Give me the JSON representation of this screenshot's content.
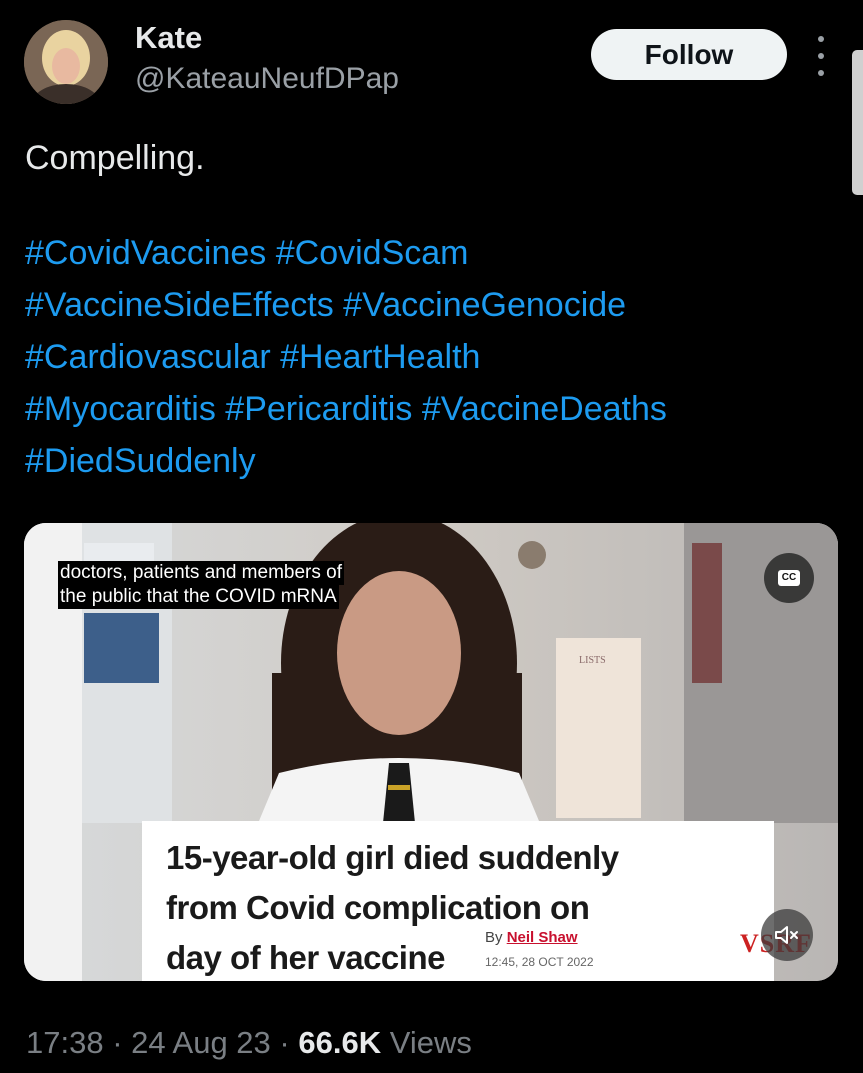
{
  "author": {
    "name": "Kate",
    "handle": "@KateauNeufDPap",
    "follow_label": "Follow"
  },
  "tweet": {
    "text": "Compelling.",
    "hashtag_lines": [
      [
        "#CovidVaccines",
        "#CovidScam"
      ],
      [
        "#VaccineSideEffects",
        "#VaccineGenocide"
      ],
      [
        "#Cardiovascular",
        "#HeartHealth"
      ],
      [
        "#Myocarditis",
        "#Pericarditis",
        "#VaccineDeaths"
      ],
      [
        "#DiedSuddenly"
      ]
    ]
  },
  "media": {
    "caption_line1": "doctors, patients and members of",
    "caption_line2": "the public that the COVID mRNA",
    "cc_label": "CC",
    "headline": "15-year-old girl died suddenly from Covid complication on day of her vaccine",
    "headline_line1": "15-year-old girl died suddenly",
    "headline_line2": "from Covid complication on",
    "headline_line3": "day of her vaccine",
    "byline_prefix": "By",
    "byline_author": "Neil Shaw",
    "byline_date": "12:45, 28 OCT 2022",
    "watermark": "VSRF",
    "fridge_note": "LISTS"
  },
  "footer": {
    "time": "17:38",
    "date": "24 Aug 23",
    "views_count": "66.6K",
    "views_label": "Views",
    "separator": "·"
  },
  "colors": {
    "background": "#000000",
    "text": "#e7e9ea",
    "secondary": "#7a7f84",
    "hashtag": "#1d9bf0",
    "follow_bg": "#eff3f4"
  }
}
